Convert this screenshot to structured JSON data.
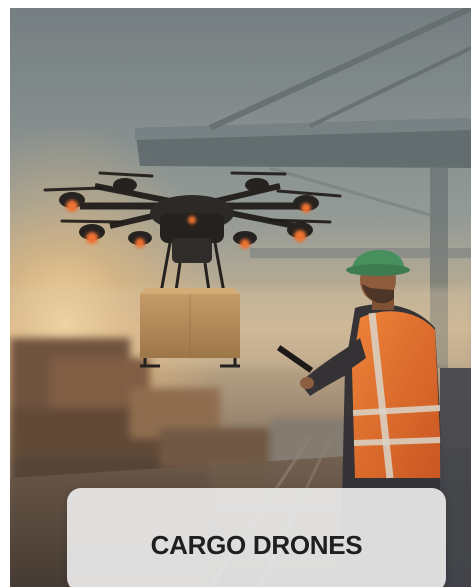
{
  "card": {
    "caption": "CARGO DRONES",
    "scene": {
      "subject_icon": "drone-icon",
      "package_icon": "package-icon",
      "worker_icon": "worker-icon",
      "crane_icon": "crane-icon"
    },
    "colors": {
      "sky_top": "#7f8d92",
      "sky_bottom": "#c9b79a",
      "sun_glow": "#f3c98a",
      "helmet": "#3f8f5e",
      "vest": "#ec6f2a",
      "drone_lights": "#f0702f",
      "box": "#b58e5c",
      "caption_bg": "#eaeaea",
      "caption_text": "#1f1f1f"
    }
  }
}
